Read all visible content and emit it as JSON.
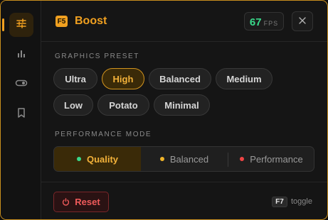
{
  "app": {
    "logo_badge": "F5",
    "title": "Boost",
    "accent_color": "#f0a020"
  },
  "fps": {
    "value": "67",
    "unit": "FPS"
  },
  "sidebar": {
    "items": [
      {
        "icon": "sliders-icon",
        "active": true
      },
      {
        "icon": "bar-chart-icon",
        "active": false
      },
      {
        "icon": "toggle-icon",
        "active": false
      },
      {
        "icon": "bookmark-icon",
        "active": false
      }
    ]
  },
  "graphics_preset": {
    "label": "GRAPHICS PRESET",
    "selected": "High",
    "options": [
      "Ultra",
      "High",
      "Balanced",
      "Medium",
      "Low",
      "Potato",
      "Minimal"
    ]
  },
  "performance_mode": {
    "label": "PERFORMANCE MODE",
    "selected": "Quality",
    "options": [
      {
        "label": "Quality",
        "dot_color": "#39d98a"
      },
      {
        "label": "Balanced",
        "dot_color": "#f0b429"
      },
      {
        "label": "Performance",
        "dot_color": "#ef4444"
      }
    ]
  },
  "footer": {
    "reset_label": "Reset",
    "hotkey": "F7",
    "hotkey_hint": "toggle"
  }
}
